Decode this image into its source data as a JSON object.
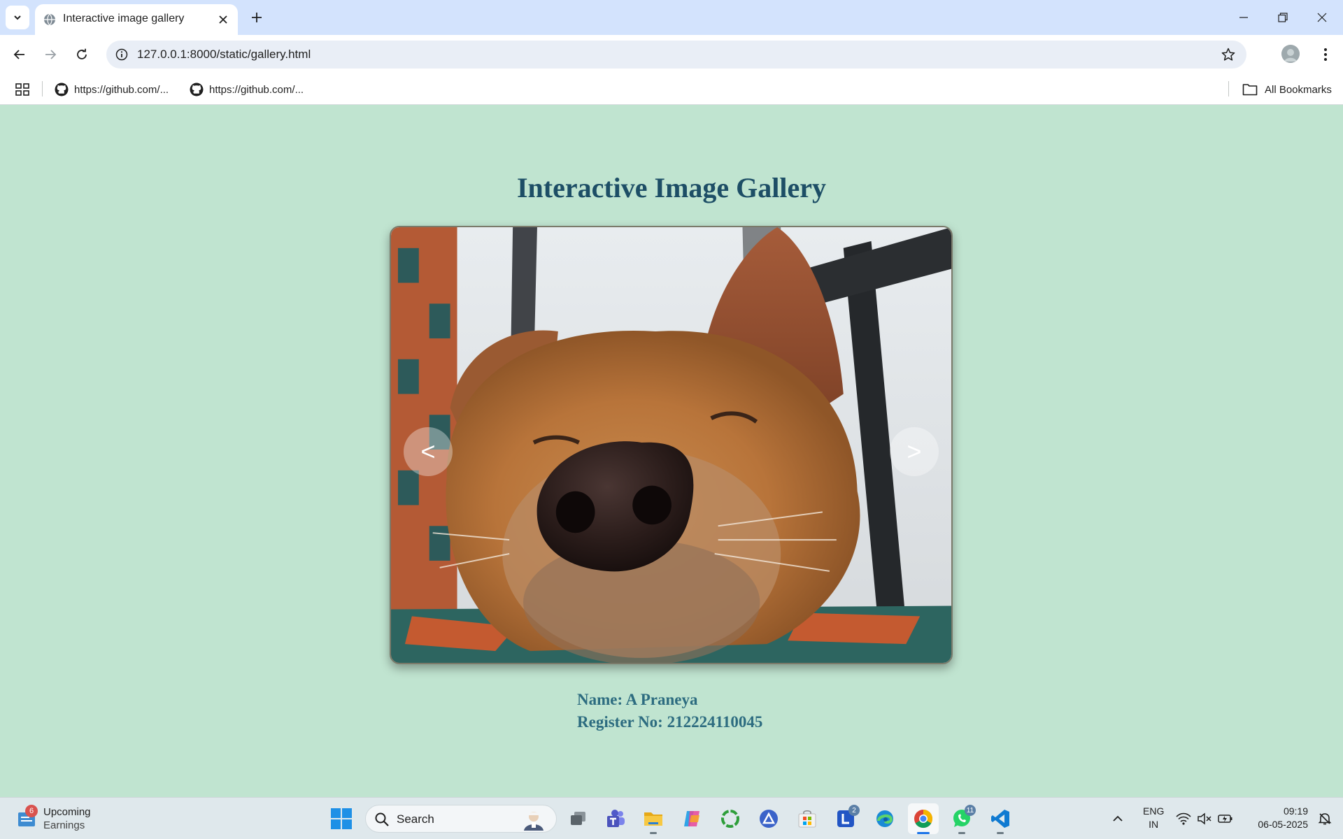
{
  "browser": {
    "tab": {
      "title": "Interactive image gallery"
    },
    "address": {
      "url": "127.0.0.1:8000/static/gallery.html"
    },
    "bookmarks": [
      {
        "label": "https://github.com/..."
      },
      {
        "label": "https://github.com/..."
      }
    ],
    "all_bookmarks_label": "All Bookmarks"
  },
  "page": {
    "title": "Interactive Image Gallery",
    "prev_label": "<",
    "next_label": ">",
    "name_line": "Name: A Praneya",
    "register_line": "Register No: 212224110045",
    "background_color": "#c0e4d0",
    "title_color": "#1d4e66"
  },
  "taskbar": {
    "widget": {
      "title": "Upcoming",
      "subtitle": "Earnings",
      "badge": "6"
    },
    "search_placeholder": "Search",
    "apps": [
      {
        "name": "task-view",
        "badge": ""
      },
      {
        "name": "teams",
        "badge": ""
      },
      {
        "name": "file-explorer",
        "badge": ""
      },
      {
        "name": "copilot",
        "badge": ""
      },
      {
        "name": "app-circle",
        "badge": ""
      },
      {
        "name": "app-delta",
        "badge": ""
      },
      {
        "name": "microsoft-store",
        "badge": ""
      },
      {
        "name": "app-l",
        "badge": "2"
      },
      {
        "name": "edge",
        "badge": ""
      },
      {
        "name": "chrome",
        "badge": ""
      },
      {
        "name": "whatsapp",
        "badge": "11"
      },
      {
        "name": "vscode",
        "badge": ""
      }
    ],
    "language": {
      "line1": "ENG",
      "line2": "IN"
    },
    "clock": {
      "time": "09:19",
      "date": "06-05-2025"
    }
  }
}
